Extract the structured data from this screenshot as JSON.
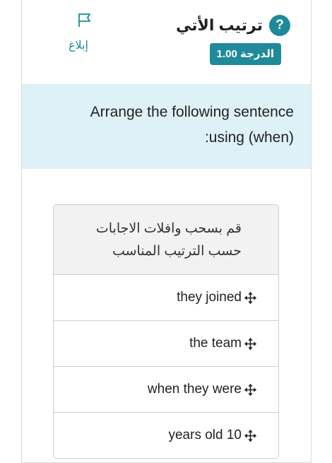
{
  "header": {
    "help_symbol": "?",
    "title": "ترتيب الأتي",
    "grade": "الدرجة 1.00",
    "report_label": "إبلاغ",
    "report_icon": "flag-icon"
  },
  "question": {
    "line1": "Arrange the following sentence",
    "line2": ":using (when)"
  },
  "ordering": {
    "instruction_line1": "قم بسحب وافلات الاجابات",
    "instruction_line2": "حسب الترتيب المناسب",
    "drag_icon": "move-arrows-icon",
    "items": [
      {
        "label": "they joined"
      },
      {
        "label": "the team"
      },
      {
        "label": "when they were"
      },
      {
        "label": "years old 10"
      }
    ]
  },
  "colors": {
    "accent": "#1f8a99",
    "question_bg": "#def1f6",
    "instruction_bg": "#f2f2f2"
  }
}
